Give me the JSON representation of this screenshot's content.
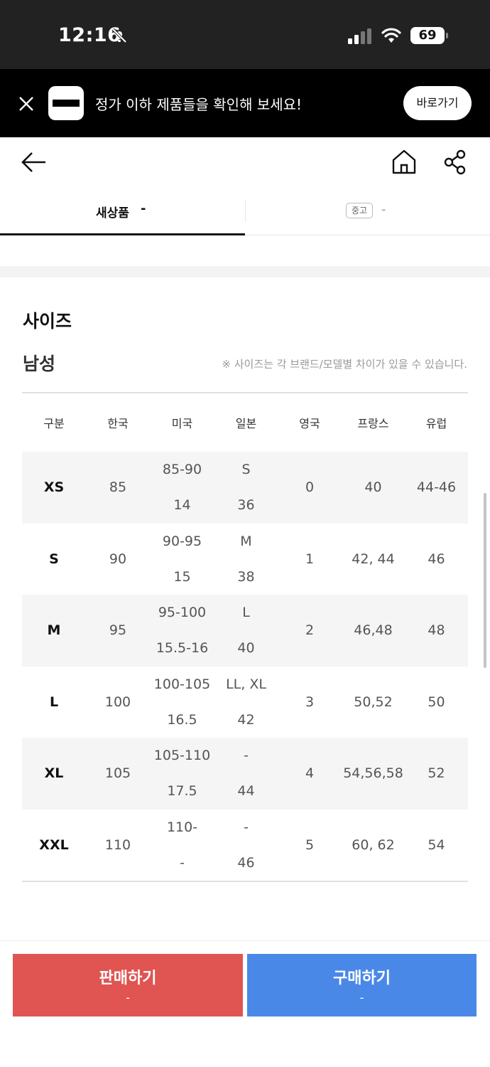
{
  "status_bar": {
    "time": "12:16",
    "battery": "69"
  },
  "promo": {
    "text": "정가 이하 제품들을 확인해 보세요!",
    "button": "바로가기"
  },
  "tabs": {
    "new_label": "새상품",
    "new_price": "-",
    "used_badge": "중고",
    "used_price": "-"
  },
  "size_section": {
    "title": "사이즈",
    "gender": "남성",
    "note": "※ 사이즈는 각 브랜드/모델별 차이가 있을 수 있습니다.",
    "headers": [
      "구분",
      "한국",
      "미국",
      "일본",
      "영국",
      "프랑스",
      "유럽"
    ],
    "rows": [
      {
        "size": "XS",
        "kr": "85",
        "us": [
          "85-90",
          "14"
        ],
        "jp": [
          "S",
          "36"
        ],
        "uk": "0",
        "fr": "40",
        "eu": "44-46"
      },
      {
        "size": "S",
        "kr": "90",
        "us": [
          "90-95",
          "15"
        ],
        "jp": [
          "M",
          "38"
        ],
        "uk": "1",
        "fr": "42, 44",
        "eu": "46"
      },
      {
        "size": "M",
        "kr": "95",
        "us": [
          "95-100",
          "15.5-16"
        ],
        "jp": [
          "L",
          "40"
        ],
        "uk": "2",
        "fr": "46,48",
        "eu": "48"
      },
      {
        "size": "L",
        "kr": "100",
        "us": [
          "100-105",
          "16.5"
        ],
        "jp": [
          "LL, XL",
          "42"
        ],
        "uk": "3",
        "fr": "50,52",
        "eu": "50"
      },
      {
        "size": "XL",
        "kr": "105",
        "us": [
          "105-110",
          "17.5"
        ],
        "jp": [
          "-",
          "44"
        ],
        "uk": "4",
        "fr": "54,56,58",
        "eu": "52"
      },
      {
        "size": "XXL",
        "kr": "110",
        "us": [
          "110-",
          "-"
        ],
        "jp": [
          "-",
          "46"
        ],
        "uk": "5",
        "fr": "60, 62",
        "eu": "54"
      }
    ]
  },
  "bottom_bar": {
    "sell_label": "판매하기",
    "sell_price": "-",
    "buy_label": "구매하기",
    "buy_price": "-"
  },
  "colors": {
    "sell": "#e05451",
    "buy": "#4a88e8",
    "banner": "#000000"
  },
  "icons": [
    "bell-slash-icon",
    "signal-icon",
    "wifi-icon",
    "close-icon",
    "back-arrow-icon",
    "home-icon",
    "share-icon"
  ]
}
